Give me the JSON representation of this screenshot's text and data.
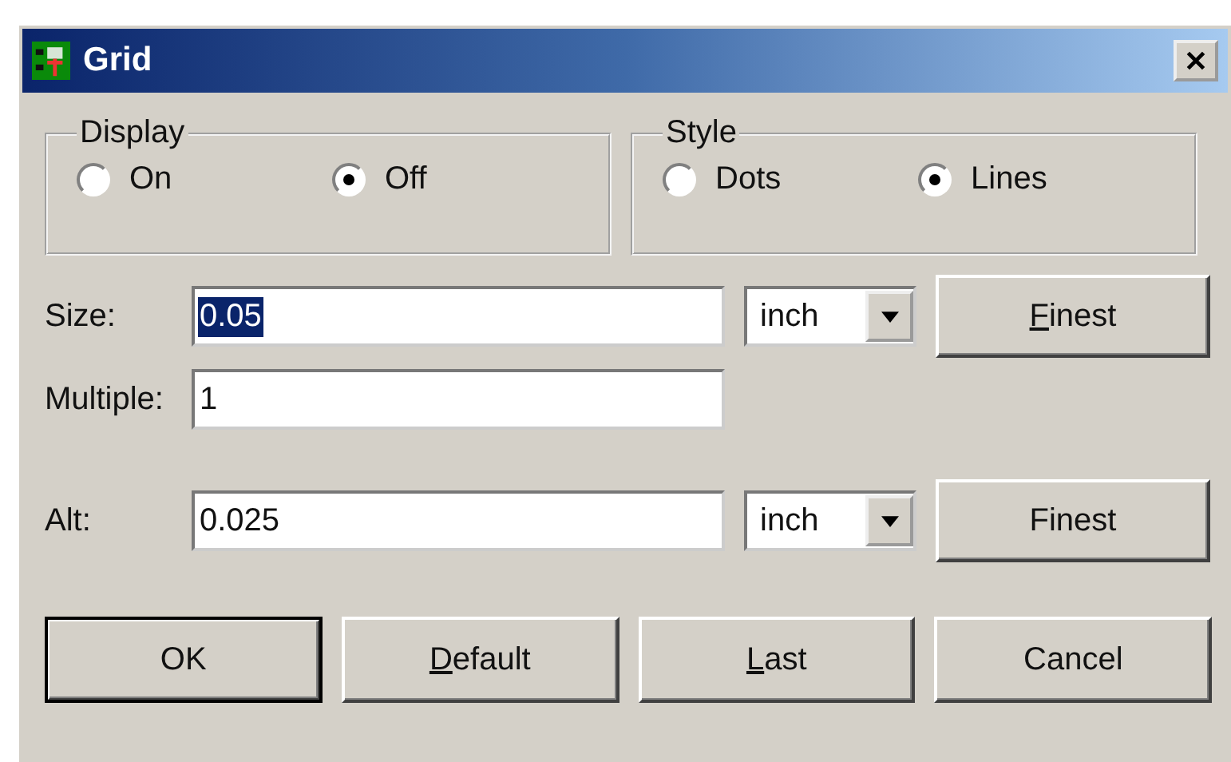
{
  "window": {
    "title": "Grid"
  },
  "groups": [
    {
      "title": "Display",
      "options": [
        {
          "label": "On",
          "selected": false
        },
        {
          "label": "Off",
          "selected": true
        }
      ]
    },
    {
      "title": "Style",
      "options": [
        {
          "label": "Dots",
          "selected": false
        },
        {
          "label": "Lines",
          "selected": true
        }
      ]
    }
  ],
  "fields": [
    {
      "label": "Size:",
      "value": "0.05",
      "value_selected": true,
      "unit": "inch",
      "button": {
        "label": "Finest",
        "underline_first": true
      }
    },
    {
      "label": "Multiple:",
      "value": "1",
      "value_selected": false
    },
    {
      "label": "Alt:",
      "value": "0.025",
      "value_selected": false,
      "unit": "inch",
      "button": {
        "label": "Finest",
        "underline_first": false
      }
    }
  ],
  "buttons": [
    {
      "label": "OK",
      "default": true,
      "underline_first": false
    },
    {
      "label": "Default",
      "default": false,
      "underline_first": true
    },
    {
      "label": "Last",
      "default": false,
      "underline_first": true
    },
    {
      "label": "Cancel",
      "default": false,
      "underline_first": false
    }
  ]
}
